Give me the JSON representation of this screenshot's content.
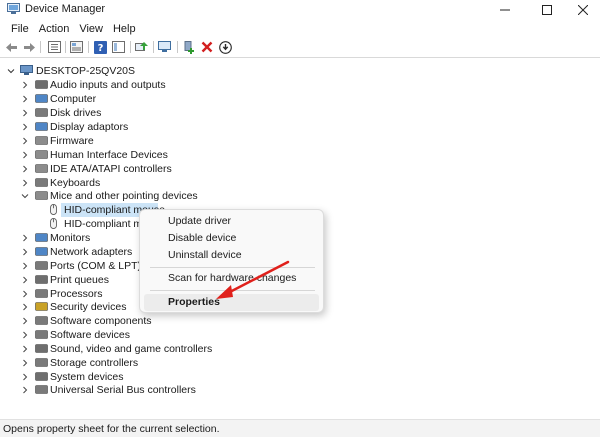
{
  "window": {
    "title": "Device Manager"
  },
  "menu": [
    "File",
    "Action",
    "View",
    "Help"
  ],
  "toolbar": {
    "icons": [
      "back-arrow-icon",
      "forward-arrow-icon",
      "device-view-icon",
      "properties-sheet-icon",
      "help-icon",
      "action-view-icon",
      "update-driver-icon",
      "scan-hardware-icon",
      "add-driver-icon",
      "uninstall-x-icon",
      "disable-device-icon"
    ]
  },
  "tree": {
    "root": "DESKTOP-25QV20S",
    "categories": [
      "Audio inputs and outputs",
      "Computer",
      "Disk drives",
      "Display adaptors",
      "Firmware",
      "Human Interface Devices",
      "IDE ATA/ATAPI controllers",
      "Keyboards",
      "Mice and other pointing devices",
      "Monitors",
      "Network adapters",
      "Ports (COM & LPT)",
      "Print queues",
      "Processors",
      "Security devices",
      "Software components",
      "Software devices",
      "Sound, video and game controllers",
      "Storage controllers",
      "System devices",
      "Universal Serial Bus controllers"
    ],
    "mice_children": [
      "HID-compliant mouse",
      "HID-compliant mo"
    ]
  },
  "context_menu": {
    "items": [
      "Update driver",
      "Disable device",
      "Uninstall device",
      "Scan for hardware changes",
      "Properties"
    ],
    "highlighted": "Properties"
  },
  "status": {
    "text": "Opens property sheet for the current selection."
  },
  "colors": {
    "selection": "#cce4f7",
    "annotation_arrow": "#e0201b",
    "uninstall_x": "#d21f1f"
  }
}
